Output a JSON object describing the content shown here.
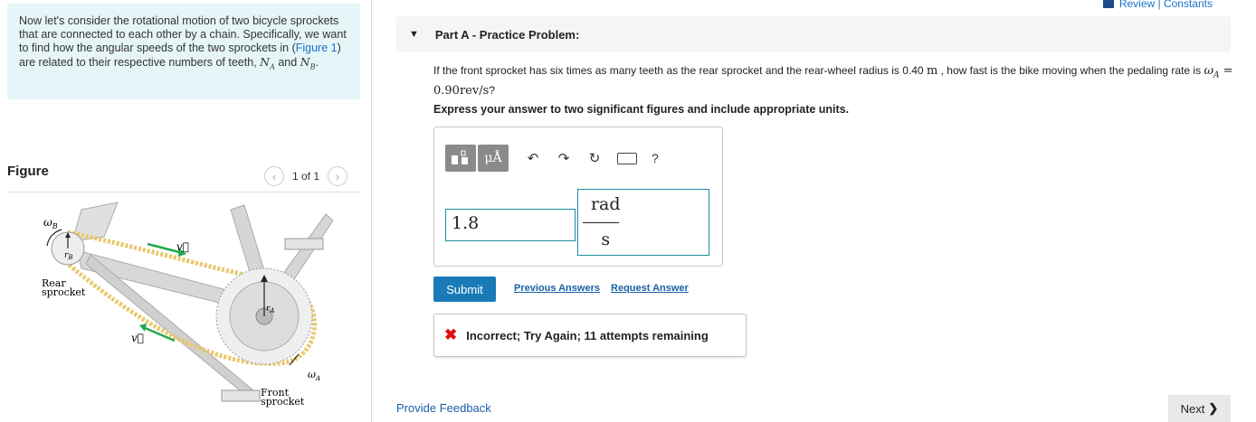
{
  "intro": {
    "part1": "Now let's consider the rotational motion of two bicycle sprockets that are connected to each other by a chain. Specifically, we want to find how the angular speeds of the two sprockets in (",
    "figure_link": "Figure 1",
    "part2": ") are related to their respective numbers of teeth, ",
    "na": "N",
    "na_sub": "A",
    "and": " and ",
    "nb": "N",
    "nb_sub": "B",
    "end": "."
  },
  "figure": {
    "title": "Figure",
    "counter": "1 of 1",
    "prev_icon": "chevron-left-icon",
    "next_icon": "chevron-right-icon",
    "labels": {
      "omega_b": "ω",
      "omega_b_sub": "B",
      "r_b": "r",
      "r_b_sub": "B",
      "v_top": "v⃗",
      "v_bottom": "v⃗",
      "rear_1": "Rear",
      "rear_2": "sprocket",
      "r_a": "r",
      "r_a_sub": "A",
      "omega_a": "ω",
      "omega_a_sub": "A",
      "front_1": "Front",
      "front_2": "sprocket"
    }
  },
  "header": {
    "review_label": "Review | Constants",
    "part_title": "Part A - Practice Problem:"
  },
  "question": {
    "text1": "If the front sprocket has six times as many teeth as the rear sprocket and the rear-wheel radius is 0.40 ",
    "unit_m": "m",
    "text2": " , how fast is the bike moving when the pedaling rate is ",
    "omega": "ω",
    "omega_sub": "A",
    "eq": " = 0.90rev/s",
    "qmark": "?",
    "express": "Express your answer to two significant figures and include appropriate units."
  },
  "toolbar": {
    "template_icon": "template-icon",
    "units_label": "μÅ",
    "undo_icon": "undo-icon",
    "redo_icon": "redo-icon",
    "reset_icon": "reset-icon",
    "keyboard_icon": "keyboard-icon",
    "help_label": "?"
  },
  "answer": {
    "value": "1.8",
    "unit_numerator": "rad",
    "unit_denominator": "s"
  },
  "actions": {
    "submit_label": "Submit",
    "previous_answers": "Previous Answers",
    "request_answer": "Request Answer"
  },
  "feedback": {
    "status_text": "Incorrect; Try Again; 11 attempts remaining",
    "status_color": "#dd1111"
  },
  "footer": {
    "provide_feedback": "Provide Feedback",
    "next_label": "Next"
  },
  "colors": {
    "accent": "#1a7ab8",
    "link": "#1a5fa8",
    "intro_bg": "#e6f5f7",
    "input_border": "#1a8fa0"
  }
}
